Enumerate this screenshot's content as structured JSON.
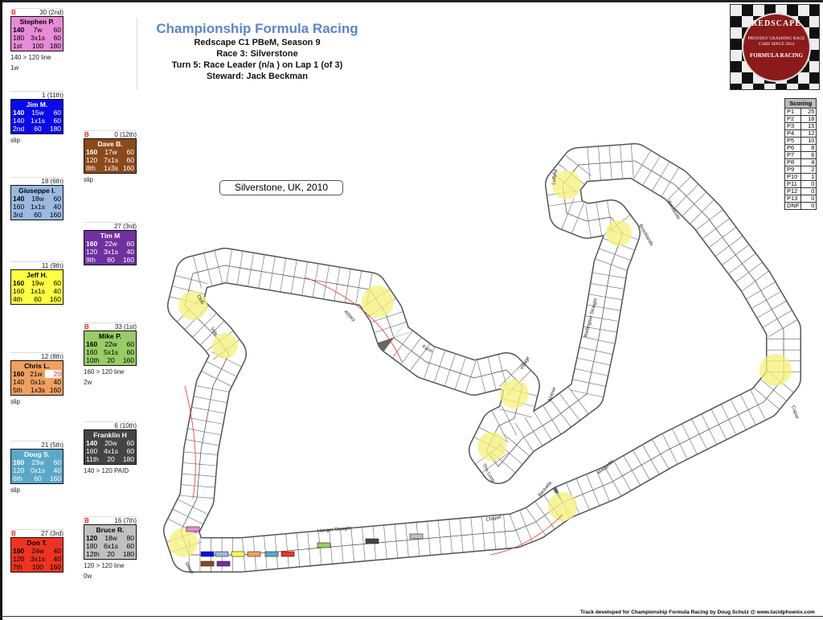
{
  "header": {
    "title": "Championship Formula Racing",
    "lines": [
      "Redscape C1 PBeM, Season 9",
      "Race 3: Silverstone",
      "Turn 5: Race Leader (n/a  ) on Lap 1 (of 3)",
      "Steward: Jack Beckman"
    ]
  },
  "logo": {
    "top": "REDSCAPE",
    "middle": "PROUDLY CRASHING RACE CARS SINCE 2014",
    "bottom": "FORMULA RACING"
  },
  "track_location": "Silverstone, UK, 2010",
  "credit": "Track developed for Championship Formula Racing by Doug Schulz @ www.lucidphoenix.com",
  "scoring": {
    "title": "Scoring",
    "rows": [
      [
        "P1",
        "25"
      ],
      [
        "P2",
        "18"
      ],
      [
        "P3",
        "15"
      ],
      [
        "P4",
        "12"
      ],
      [
        "P5",
        "10"
      ],
      [
        "P6",
        "8"
      ],
      [
        "P7",
        "6"
      ],
      [
        "P8",
        "4"
      ],
      [
        "P9",
        "2"
      ],
      [
        "P10",
        "1"
      ],
      [
        "P11",
        "0"
      ],
      [
        "P12",
        "0"
      ],
      [
        "P13",
        "0"
      ],
      [
        "DNF",
        "0"
      ]
    ]
  },
  "drivers": [
    {
      "name": "Stephen P.",
      "b": "B",
      "points": "30 (2nd)",
      "color": "#e88ad8",
      "text": "#000",
      "rows": [
        [
          "140",
          "7w",
          "60"
        ],
        [
          "180",
          "3x1s",
          "60"
        ],
        [
          "1st",
          "100",
          "180"
        ]
      ],
      "notes": [
        "140 > 120 line",
        "1w"
      ]
    },
    {
      "name": "Jim M.",
      "b": "",
      "points": "1 (11th)",
      "color": "#0a0ae8",
      "text": "#fff",
      "rows": [
        [
          "140",
          "15w",
          "60"
        ],
        [
          "140",
          "1x1s",
          "60"
        ],
        [
          "2nd",
          "60",
          "180"
        ]
      ],
      "notes": [
        "slip"
      ]
    },
    {
      "name": "Giuseppe I.",
      "b": "",
      "points": "18 (6th)",
      "color": "#9ab8e0",
      "text": "#000",
      "rows": [
        [
          "140",
          "18w",
          "60"
        ],
        [
          "160",
          "1x1s",
          "40"
        ],
        [
          "3rd",
          "60",
          "160"
        ]
      ],
      "notes": []
    },
    {
      "name": "Jeff H.",
      "b": "",
      "points": "11 (9th)",
      "color": "#ffff44",
      "text": "#000",
      "rows": [
        [
          "160",
          "19w",
          "60"
        ],
        [
          "160",
          "1x1s",
          "40"
        ],
        [
          "4th",
          "60",
          "160"
        ]
      ],
      "notes": []
    },
    {
      "name": "Chris L.",
      "b": "",
      "points": "12 (8th)",
      "color": "#f0a060",
      "text": "#000",
      "rows": [
        [
          "160",
          "21w",
          "20"
        ],
        [
          "140",
          "0x1s",
          "40"
        ],
        [
          "5th",
          "1x3s",
          "160"
        ]
      ],
      "notes": [
        "slip"
      ]
    },
    {
      "name": "Doug S.",
      "b": "",
      "points": "21 (5th)",
      "color": "#5aa8c8",
      "text": "#fff",
      "rows": [
        [
          "160",
          "23w",
          "60"
        ],
        [
          "120",
          "0x1s",
          "40"
        ],
        [
          "6th",
          "60",
          "160"
        ]
      ],
      "notes": [
        "slip"
      ]
    },
    {
      "name": "Don T.",
      "b": "B",
      "points": "27 (3rd)",
      "color": "#ee3322",
      "text": "#000",
      "rows": [
        [
          "160",
          "24w",
          "40"
        ],
        [
          "120",
          "3x1s",
          "40"
        ],
        [
          "7th",
          "100",
          "160"
        ]
      ],
      "notes": []
    },
    {
      "name": "Dave B.",
      "b": "B",
      "points": "0 (12th)",
      "color": "#8b4a1c",
      "text": "#fff",
      "rows": [
        [
          "160",
          "17w",
          "60"
        ],
        [
          "120",
          "7x1s",
          "60"
        ],
        [
          "8th",
          "1x3s",
          "160"
        ]
      ],
      "notes": [
        "slip"
      ]
    },
    {
      "name": "Tim M",
      "b": "",
      "points": "27 (3rd)",
      "color": "#7030a0",
      "text": "#fff",
      "rows": [
        [
          "160",
          "22w",
          "60"
        ],
        [
          "120",
          "3x1s",
          "40"
        ],
        [
          "9th",
          "60",
          "160"
        ]
      ],
      "notes": []
    },
    {
      "name": "Mike P.",
      "b": "B",
      "points": "33 (1st)",
      "color": "#99cc66",
      "text": "#000",
      "rows": [
        [
          "160",
          "22w",
          "60"
        ],
        [
          "160",
          "5x1s",
          "60"
        ],
        [
          "10th",
          "20",
          "160"
        ]
      ],
      "notes": [
        "160 > 120 line",
        "2w"
      ]
    },
    {
      "name": "Franklin H",
      "b": "",
      "points": "6 (10th)",
      "color": "#444444",
      "text": "#fff",
      "rows": [
        [
          "140",
          "20w",
          "60"
        ],
        [
          "160",
          "4x1s",
          "60"
        ],
        [
          "11th",
          "20",
          "180"
        ]
      ],
      "notes": [
        "140 > 120 PAID"
      ]
    },
    {
      "name": "Bruce R.",
      "b": "B",
      "points": "16 (7th)",
      "color": "#c0c0c0",
      "text": "#000",
      "rows": [
        [
          "120",
          "18w",
          "80"
        ],
        [
          "180",
          "6x1s",
          "60"
        ],
        [
          "12th",
          "20",
          "180"
        ]
      ],
      "notes": [
        "120 > 120 line",
        "0w"
      ]
    }
  ],
  "corners": [
    "Club",
    "Vale",
    "Abbey",
    "Farm",
    "Village",
    "The Loop",
    "Aintree",
    "Wellington Straight",
    "Brooklands",
    "Luffield",
    "Woodcote",
    "Copse",
    "Maggotts",
    "Becketts",
    "Chapel",
    "Hanger Straight",
    "Stowe"
  ]
}
